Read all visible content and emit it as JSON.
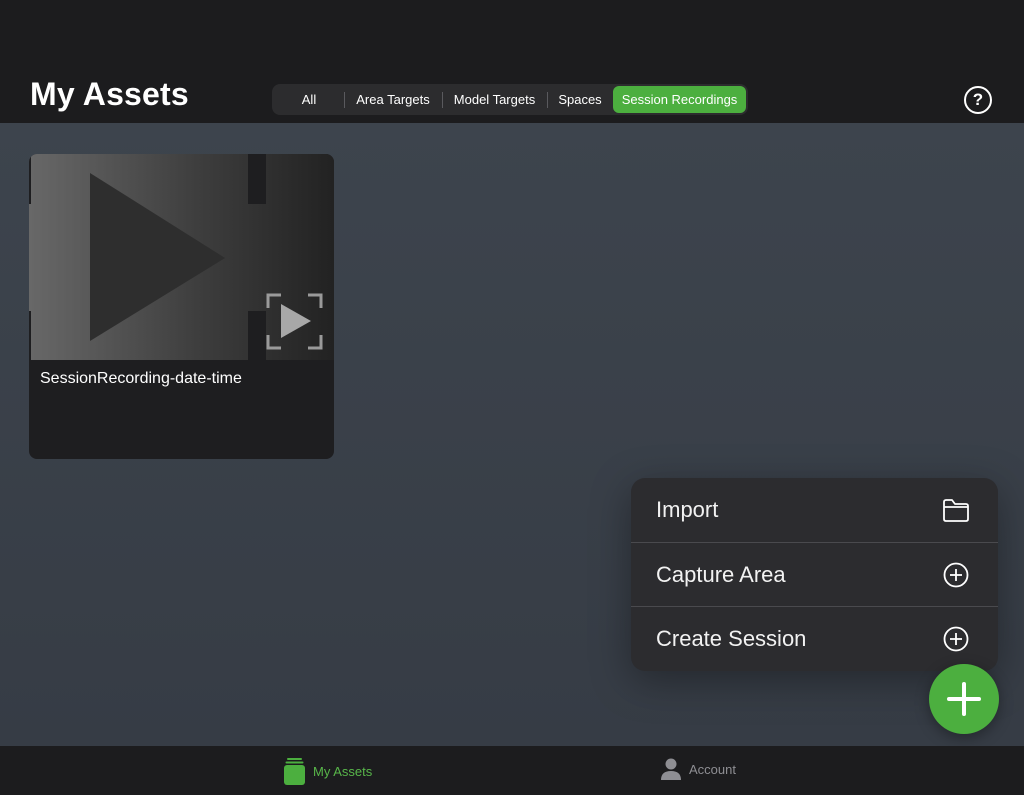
{
  "header": {
    "title": "My Assets",
    "tabs": [
      {
        "label": "All"
      },
      {
        "label": "Area Targets"
      },
      {
        "label": "Model Targets"
      },
      {
        "label": "Spaces"
      },
      {
        "label": "Session Recordings"
      }
    ],
    "selected_tab": "Session Recordings",
    "help_label": "?"
  },
  "assets": [
    {
      "name": "SessionRecording-date-time",
      "icon": "session-recording-icon"
    }
  ],
  "add_menu": {
    "items": [
      {
        "label": "Import",
        "icon": "folder-icon"
      },
      {
        "label": "Capture Area",
        "icon": "plus-circle-icon"
      },
      {
        "label": "Create Session",
        "icon": "plus-circle-icon"
      }
    ]
  },
  "tab_bar": {
    "items": [
      {
        "label": "My Assets",
        "icon": "assets-icon"
      },
      {
        "label": "Account",
        "icon": "person-icon"
      }
    ],
    "selected": "My Assets"
  },
  "colors": {
    "accent": "#4caf3f",
    "header_bg": "#1c1c1e",
    "content_bg": "#3b424b",
    "menu_bg": "#2c2c2f"
  }
}
